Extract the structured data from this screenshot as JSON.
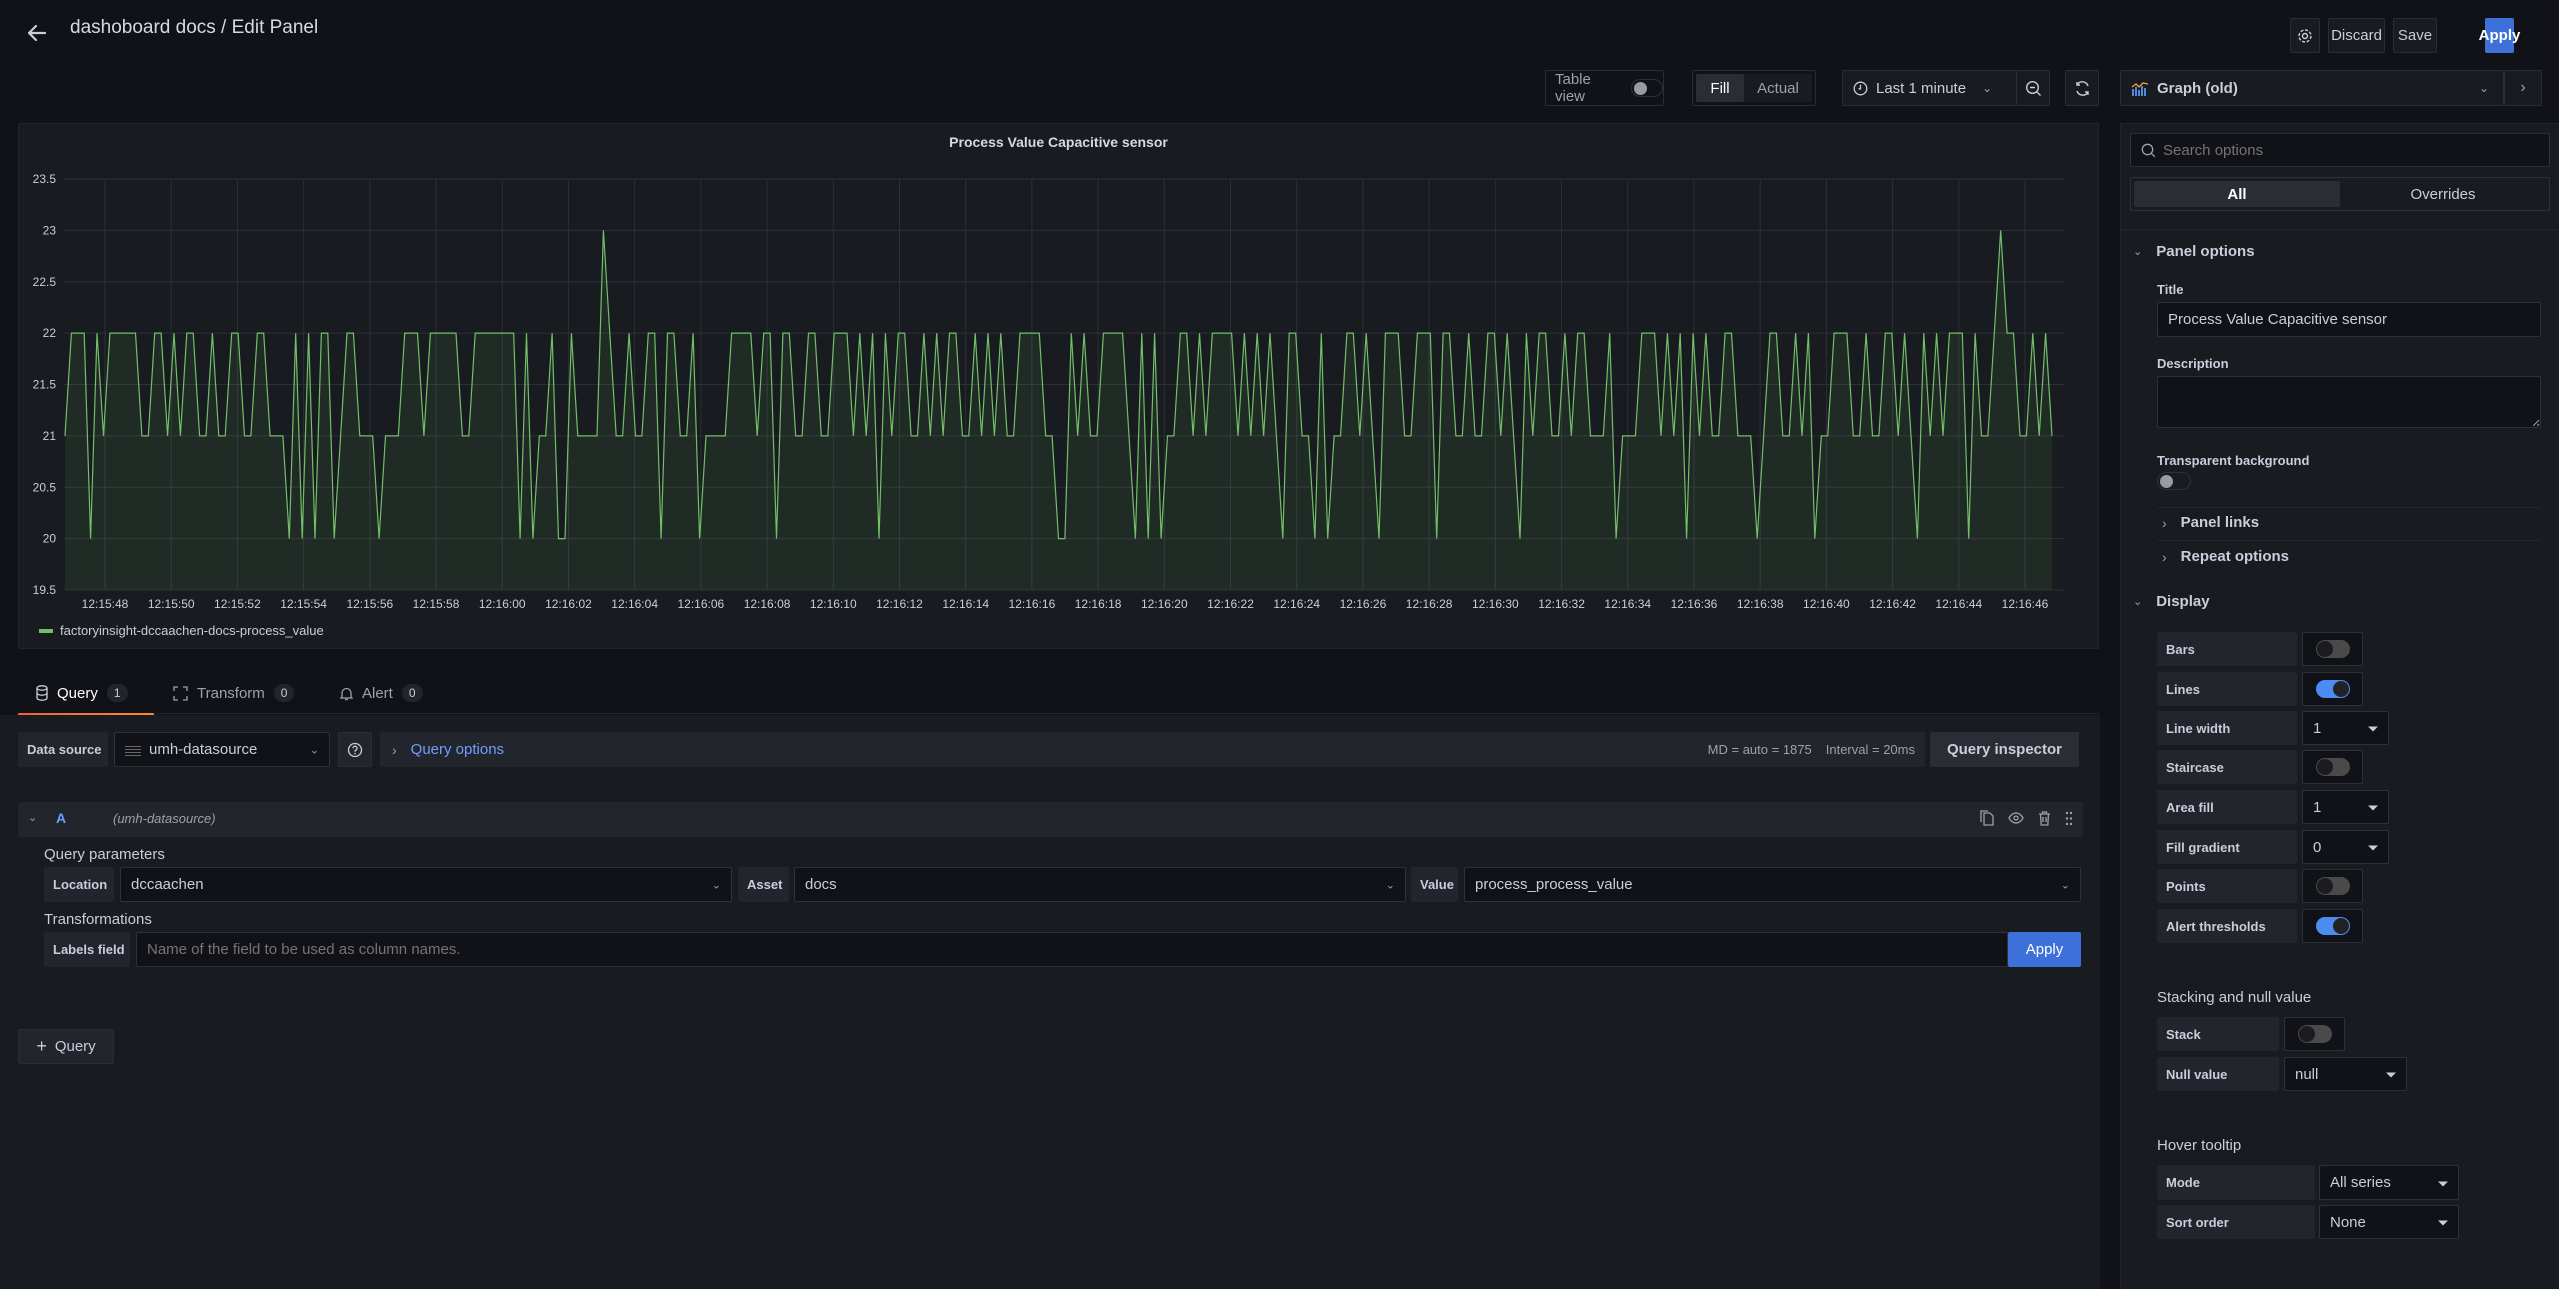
{
  "header": {
    "title": "dashoboard docs / Edit Panel",
    "discard_label": "Discard",
    "save_label": "Save",
    "apply_label": "Apply"
  },
  "toolbar": {
    "table_view_label": "Table view",
    "table_view_on": false,
    "fill_label": "Fill",
    "actual_label": "Actual",
    "time_range": "Last 1 minute",
    "viz_name": "Graph (old)"
  },
  "panel": {
    "title": "Process Value Capacitive sensor",
    "legend": "factoryinsight-dccaachen-docs-process_value"
  },
  "chart_data": {
    "type": "line",
    "title": "Process Value Capacitive sensor",
    "xlabel": "",
    "ylabel": "",
    "ylim": [
      19.5,
      23.5
    ],
    "yticks": [
      "23.5",
      "23",
      "22.5",
      "22",
      "21.5",
      "21",
      "20.5",
      "20",
      "19.5"
    ],
    "xticks": [
      "12:15:48",
      "12:15:50",
      "12:15:52",
      "12:15:54",
      "12:15:56",
      "12:15:58",
      "12:16:00",
      "12:16:02",
      "12:16:04",
      "12:16:06",
      "12:16:08",
      "12:16:10",
      "12:16:12",
      "12:16:14",
      "12:16:16",
      "12:16:18",
      "12:16:20",
      "12:16:22",
      "12:16:24",
      "12:16:26",
      "12:16:28",
      "12:16:30",
      "12:16:32",
      "12:16:34",
      "12:16:36",
      "12:16:38",
      "12:16:40",
      "12:16:42",
      "12:16:44",
      "12:16:46"
    ],
    "grid": true,
    "area_fill": true,
    "legend_position": "bottom-left",
    "series": [
      {
        "name": "factoryinsight-dccaachen-docs-process_value",
        "color": "#73bf69",
        "values": [
          21,
          22,
          22,
          22,
          20,
          22,
          21,
          22,
          22,
          22,
          22,
          22,
          21,
          21,
          22,
          22,
          21,
          22,
          21,
          22,
          22,
          21,
          21,
          22,
          21,
          21,
          22,
          22,
          21,
          21,
          22,
          22,
          21,
          21,
          21,
          20,
          22,
          20,
          22,
          20,
          22,
          22,
          20,
          21,
          22,
          22,
          21,
          21,
          21,
          20,
          21,
          21,
          21,
          22,
          22,
          22,
          21,
          22,
          22,
          22,
          22,
          22,
          21,
          21,
          22,
          22,
          22,
          22,
          22,
          22,
          22,
          20,
          22,
          20,
          21,
          21,
          22,
          20,
          20,
          22,
          21,
          21,
          21,
          21,
          23,
          22,
          21,
          21,
          22,
          21,
          21,
          22,
          22,
          20,
          22,
          22,
          21,
          21,
          22,
          20,
          21,
          21,
          21,
          21,
          22,
          22,
          22,
          22,
          21,
          22,
          22,
          20,
          22,
          22,
          21,
          21,
          22,
          22,
          21,
          21,
          22,
          22,
          22,
          21,
          22,
          21,
          22,
          20,
          22,
          21,
          22,
          22,
          21,
          21,
          22,
          21,
          22,
          21,
          22,
          22,
          21,
          21,
          22,
          21,
          22,
          21,
          22,
          21,
          21,
          22,
          22,
          22,
          22,
          21,
          21,
          20,
          20,
          22,
          21,
          22,
          21,
          21,
          22,
          22,
          22,
          22,
          21,
          20,
          22,
          20,
          22,
          20,
          21,
          21,
          22,
          22,
          21,
          22,
          21,
          22,
          22,
          22,
          22,
          21,
          22,
          21,
          22,
          21,
          22,
          21,
          20,
          22,
          22,
          21,
          21,
          20,
          22,
          20,
          21,
          21,
          22,
          22,
          21,
          22,
          21,
          20,
          22,
          22,
          22,
          21,
          21,
          22,
          22,
          22,
          20,
          22,
          22,
          21,
          21,
          22,
          21,
          21,
          22,
          22,
          21,
          22,
          21,
          20,
          22,
          21,
          22,
          22,
          21,
          21,
          22,
          21,
          22,
          22,
          21,
          21,
          21,
          22,
          20,
          21,
          21,
          21,
          22,
          22,
          22,
          21,
          22,
          21,
          22,
          20,
          22,
          21,
          22,
          21,
          21,
          22,
          22,
          21,
          21,
          21,
          20,
          21,
          22,
          22,
          21,
          21,
          22,
          21,
          22,
          20,
          21,
          21,
          22,
          22,
          22,
          21,
          21,
          22,
          21,
          21,
          22,
          22,
          21,
          22,
          21,
          20,
          22,
          21,
          22,
          21,
          22,
          22,
          22,
          20,
          22,
          21,
          21,
          22,
          23,
          22,
          22,
          21,
          21,
          22,
          21,
          22,
          21
        ]
      }
    ]
  },
  "tabs": [
    {
      "label": "Query",
      "count": "1",
      "active": true
    },
    {
      "label": "Transform",
      "count": "0",
      "active": false
    },
    {
      "label": "Alert",
      "count": "0",
      "active": false
    }
  ],
  "query_bar": {
    "datasource_label": "Data source",
    "datasource_value": "umh-datasource",
    "query_options_label": "Query options",
    "md_info": "MD = auto = 1875",
    "interval_info": "Interval = 20ms",
    "inspector_label": "Query inspector"
  },
  "query_a": {
    "ref_id": "A",
    "datasource": "(umh-datasource)",
    "params_heading": "Query parameters",
    "location_label": "Location",
    "location_value": "dccaachen",
    "asset_label": "Asset",
    "asset_value": "docs",
    "value_label": "Value",
    "value_value": "process_process_value",
    "transforms_heading": "Transformations",
    "labels_field_label": "Labels field",
    "labels_field_placeholder": "Name of the field to be used as column names.",
    "labels_field_value": "",
    "apply_label": "Apply"
  },
  "add_query_label": "Query",
  "options": {
    "search_placeholder": "Search options",
    "tab_all": "All",
    "tab_overrides": "Overrides",
    "panel_options_heading": "Panel options",
    "title_label": "Title",
    "title_value": "Process Value Capacitive sensor",
    "description_label": "Description",
    "description_value": "",
    "transparent_label": "Transparent background",
    "transparent_on": false,
    "panel_links_label": "Panel links",
    "repeat_options_label": "Repeat options",
    "display_heading": "Display",
    "display": {
      "bars": {
        "label": "Bars",
        "on": false
      },
      "lines": {
        "label": "Lines",
        "on": true
      },
      "line_width": {
        "label": "Line width",
        "value": "1"
      },
      "staircase": {
        "label": "Staircase",
        "on": false
      },
      "area_fill": {
        "label": "Area fill",
        "value": "1"
      },
      "fill_gradient": {
        "label": "Fill gradient",
        "value": "0"
      },
      "points": {
        "label": "Points",
        "on": false
      },
      "alert_thresholds": {
        "label": "Alert thresholds",
        "on": true
      }
    },
    "stacking_heading": "Stacking and null value",
    "stack": {
      "label": "Stack",
      "on": false
    },
    "null_value": {
      "label": "Null value",
      "value": "null"
    },
    "tooltip_heading": "Hover tooltip",
    "mode": {
      "label": "Mode",
      "value": "All series"
    },
    "sort_order": {
      "label": "Sort order",
      "value": "None"
    }
  }
}
